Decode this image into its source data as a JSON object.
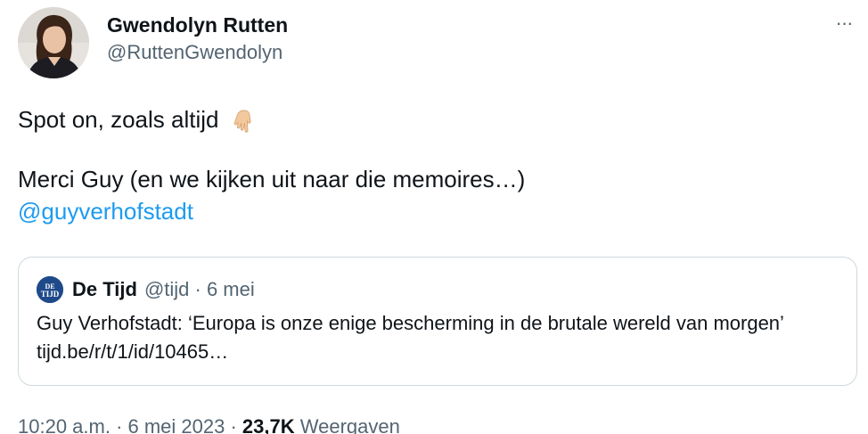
{
  "author": {
    "display_name": "Gwendolyn Rutten",
    "handle": "@RuttenGwendolyn"
  },
  "menu": {
    "more_label": "···"
  },
  "tweet": {
    "line1": "Spot on, zoals altijd",
    "line1_emoji": "backhand-index-pointing-down-emoji",
    "line2": "Merci Guy (en we kijken uit naar die memoires…)",
    "mention": "@guyverhofstadt"
  },
  "quote": {
    "logo_text": "DE TIJD",
    "name": "De Tijd",
    "handle_date": "@tijd · 6 mei",
    "text": "Guy Verhofstadt: ‘Europa is onze enige bescherming in de brutale wereld van morgen’ tijd.be/r/t/1/id/10465…"
  },
  "meta": {
    "time_date": "10:20 a.m. · 6 mei 2023 ·",
    "views_count": "23,7K",
    "views_label": "Weergaven"
  },
  "colors": {
    "link": "#1d9bf0",
    "secondary_text": "#536471",
    "border": "#cfd9de",
    "de_tijd_brand": "#1f4a8a"
  }
}
